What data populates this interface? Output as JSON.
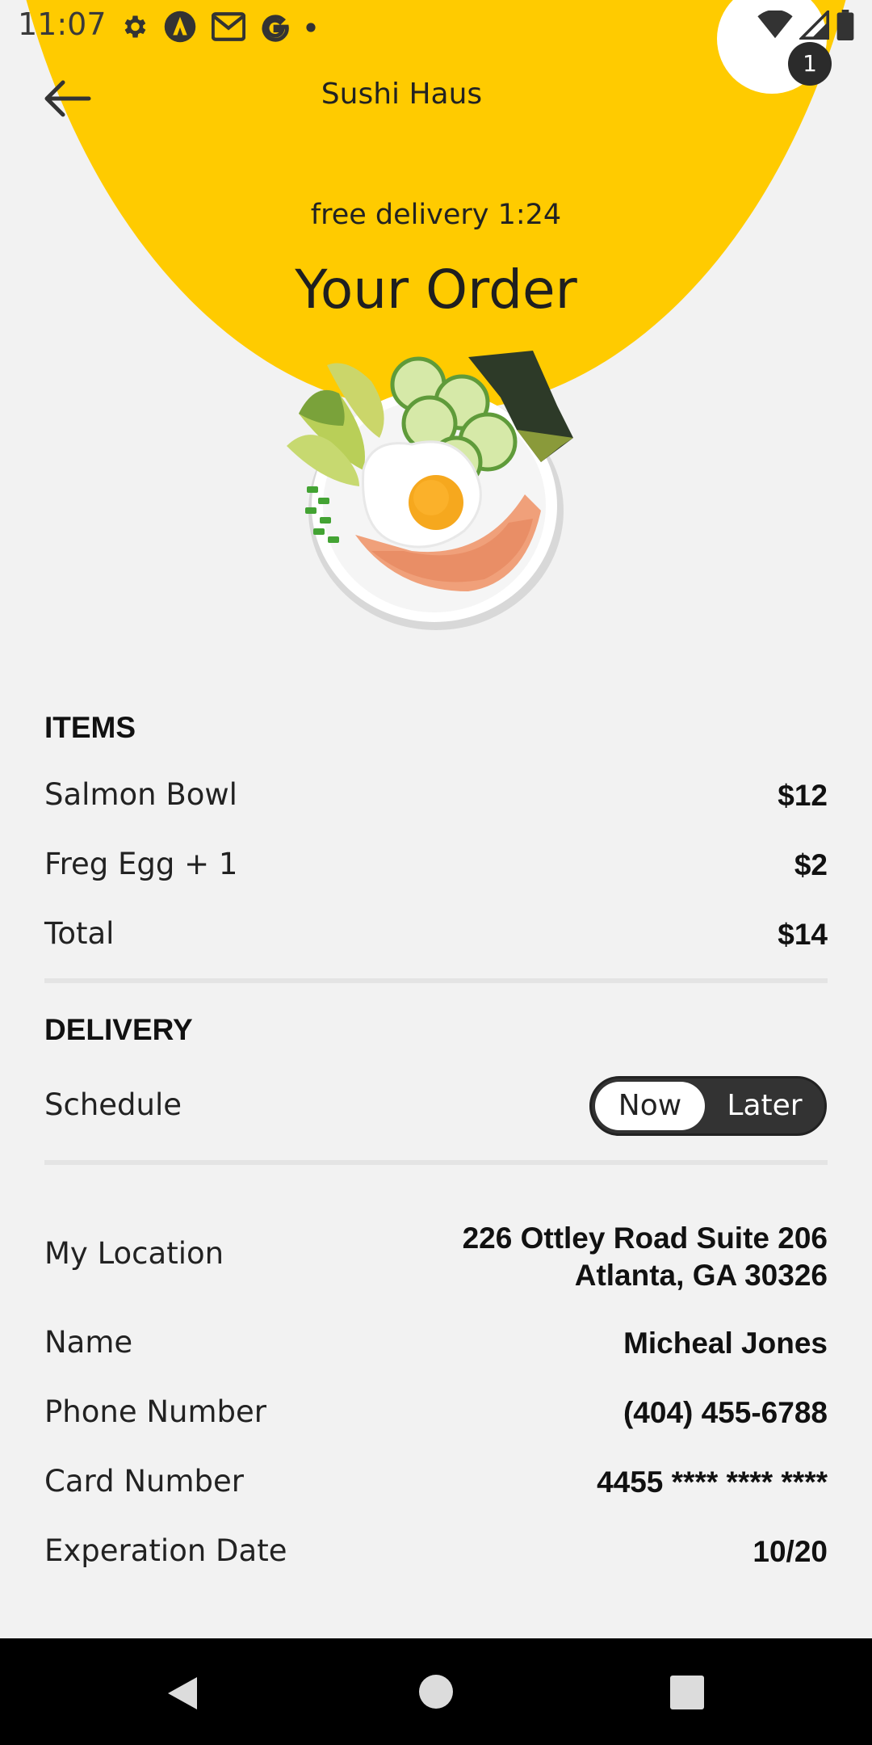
{
  "status_bar": {
    "time": "11:07",
    "left_icons": [
      "gear-icon",
      "a-logo-icon",
      "gmail-icon",
      "google-icon",
      "dot-icon"
    ],
    "right_icons": [
      "wifi-icon",
      "signal-icon",
      "battery-icon"
    ]
  },
  "header": {
    "title": "Sushi Haus",
    "cart_count": "1",
    "delivery": "free delivery 1:24",
    "order_title": "Your Order"
  },
  "items": {
    "heading": "ITEMS",
    "list": [
      {
        "label": "Salmon Bowl",
        "value": "$12"
      },
      {
        "label": "Freg Egg + 1",
        "value": "$2"
      },
      {
        "label": "Total",
        "value": "$14"
      }
    ]
  },
  "delivery": {
    "heading": "DELIVERY",
    "schedule_label": "Schedule",
    "options": [
      "Now",
      "Later"
    ],
    "selected": "Now"
  },
  "details": {
    "location_label": "My Location",
    "location_line1": "226 Ottley Road Suite 206",
    "location_line2": "Atlanta, GA 30326",
    "name_label": "Name",
    "name_value": "Micheal Jones",
    "phone_label": "Phone Number",
    "phone_value": "(404) 455-6788",
    "card_label": "Card Number",
    "card_value": "4455 **** **** ****",
    "exp_label": "Experation Date",
    "exp_value": "10/20"
  },
  "colors": {
    "accent": "#FFCB00",
    "background": "#F2F2F2",
    "toggle_dark": "#333333"
  }
}
